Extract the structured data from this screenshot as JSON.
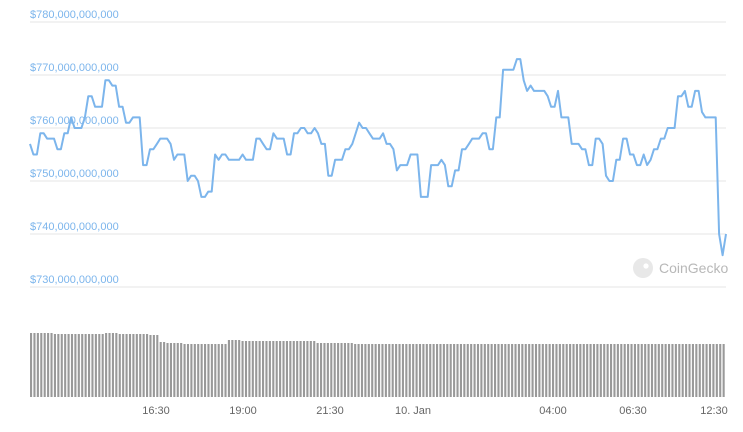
{
  "watermark": {
    "text": "CoinGecko",
    "icon": "gecko-logo-icon"
  },
  "chart_data": {
    "type": "line",
    "title": "",
    "xlabel": "",
    "ylabel": "",
    "ylim": [
      730000000000,
      780000000000
    ],
    "y_ticks": [
      {
        "value": 780000000000,
        "label": "$780,000,000,000"
      },
      {
        "value": 770000000000,
        "label": "$770,000,000,000"
      },
      {
        "value": 760000000000,
        "label": "$760,000,000,000"
      },
      {
        "value": 750000000000,
        "label": "$750,000,000,000"
      },
      {
        "value": 740000000000,
        "label": "$740,000,000,000"
      },
      {
        "value": 730000000000,
        "label": "$730,000,000,000"
      }
    ],
    "x_ticks": [
      "16:30",
      "19:00",
      "21:30",
      "10. Jan",
      "04:00",
      "06:30",
      "12:30"
    ],
    "grid": true,
    "colors": {
      "line": "#7cb5ec",
      "volume": "#999999",
      "grid": "#e6e6e6"
    },
    "series": [
      {
        "values": [
          757,
          755,
          755,
          759,
          759,
          758,
          758,
          758,
          756,
          756,
          759,
          759,
          762,
          760,
          760,
          760,
          762,
          766,
          766,
          764,
          764,
          764,
          769,
          769,
          768,
          768,
          764,
          764,
          761,
          761,
          762,
          762,
          762,
          753,
          753,
          756,
          756,
          757,
          758,
          758,
          758,
          757,
          754,
          755,
          755,
          755,
          750,
          751,
          751,
          750,
          747,
          747,
          748,
          748,
          755,
          754,
          755,
          755,
          754,
          754,
          754,
          754,
          755,
          754,
          754,
          754,
          758,
          758,
          757,
          756,
          756,
          759,
          758,
          758,
          758,
          755,
          755,
          759,
          759,
          760,
          760,
          759,
          759,
          760,
          759,
          757,
          757,
          751,
          751,
          754,
          754,
          754,
          756,
          756,
          757,
          759,
          761,
          760,
          760,
          759,
          758,
          758,
          758,
          759,
          757,
          757,
          756,
          752,
          753,
          753,
          753,
          755,
          755,
          755,
          747,
          747,
          747,
          753,
          753,
          753,
          754,
          753,
          749,
          749,
          752,
          752,
          756,
          756,
          757,
          758,
          758,
          758,
          759,
          759,
          756,
          756,
          762,
          762,
          771,
          771,
          771,
          771,
          773,
          773,
          769,
          767,
          768,
          767,
          767,
          767,
          767,
          766,
          764,
          764,
          767,
          762,
          762,
          762,
          757,
          757,
          757,
          756,
          756,
          753,
          753,
          758,
          758,
          757,
          751,
          750,
          750,
          754,
          754,
          758,
          758,
          755,
          755,
          753,
          753,
          755,
          753,
          754,
          756,
          756,
          758,
          758,
          760,
          760,
          760,
          766,
          766,
          767,
          764,
          764,
          767,
          767,
          763,
          762,
          762,
          762,
          762,
          740,
          736,
          740
        ]
      }
    ],
    "volume": {
      "values": [
        64,
        64,
        64,
        64,
        64,
        64,
        64,
        63,
        63,
        63,
        63,
        63,
        63,
        63,
        63,
        63,
        63,
        63,
        63,
        63,
        63,
        63,
        64,
        64,
        64,
        64,
        63,
        63,
        63,
        63,
        63,
        63,
        63,
        63,
        63,
        62,
        62,
        62,
        55,
        55,
        54,
        54,
        54,
        54,
        54,
        53,
        53,
        53,
        53,
        53,
        53,
        53,
        53,
        53,
        53,
        53,
        53,
        53,
        57,
        57,
        57,
        57,
        56,
        56,
        56,
        56,
        56,
        56,
        56,
        56,
        56,
        56,
        56,
        56,
        56,
        56,
        56,
        56,
        56,
        56,
        56,
        56,
        56,
        56,
        54,
        54,
        54,
        54,
        54,
        54,
        54,
        54,
        54,
        54,
        54,
        53,
        53,
        53,
        53,
        53,
        53,
        53,
        53,
        53,
        53,
        53,
        53,
        53,
        53,
        53,
        53,
        53,
        53,
        53,
        53,
        53,
        53,
        53,
        53,
        53,
        53,
        53,
        53,
        53,
        53,
        53,
        53,
        53,
        53,
        53,
        53,
        53,
        53,
        53,
        53,
        53,
        53,
        53,
        53,
        53,
        53,
        53,
        53,
        53,
        53,
        53,
        53,
        53,
        53,
        53,
        53,
        53,
        53,
        53,
        53,
        53,
        53,
        53,
        53,
        53,
        53,
        53,
        53,
        53,
        53,
        53,
        53,
        53,
        53,
        53,
        53,
        53,
        53,
        53,
        53,
        53,
        53,
        53,
        53,
        53,
        53,
        53,
        53,
        53,
        53,
        53,
        53,
        53,
        53,
        53,
        53,
        53,
        53,
        53,
        53,
        53,
        53,
        53,
        53,
        53,
        53,
        53,
        53,
        53
      ]
    }
  }
}
